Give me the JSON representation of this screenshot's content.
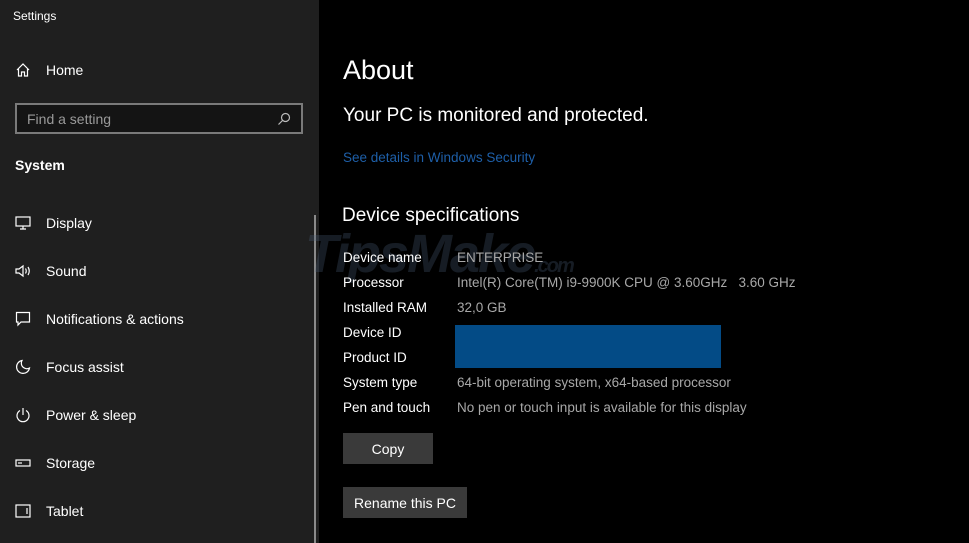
{
  "app_title": "Settings",
  "sidebar": {
    "home": "Home",
    "search_placeholder": "Find a setting",
    "section": "System",
    "items": [
      {
        "label": "Display",
        "icon": "monitor-icon"
      },
      {
        "label": "Sound",
        "icon": "speaker-icon"
      },
      {
        "label": "Notifications & actions",
        "icon": "notification-icon"
      },
      {
        "label": "Focus assist",
        "icon": "moon-icon"
      },
      {
        "label": "Power & sleep",
        "icon": "power-icon"
      },
      {
        "label": "Storage",
        "icon": "storage-icon"
      },
      {
        "label": "Tablet",
        "icon": "tablet-icon"
      }
    ]
  },
  "main": {
    "title": "About",
    "protection": "Your PC is monitored and protected.",
    "security_link": "See details in Windows Security",
    "specs_heading": "Device specifications",
    "specs": [
      {
        "label": "Device name",
        "value": "ENTERPRISE"
      },
      {
        "label": "Processor",
        "value": "Intel(R) Core(TM) i9-9900K CPU @ 3.60GHz   3.60 GHz"
      },
      {
        "label": "Installed RAM",
        "value": "32,0 GB"
      },
      {
        "label": "Device ID",
        "value": ""
      },
      {
        "label": "Product ID",
        "value": ""
      },
      {
        "label": "System type",
        "value": "64-bit operating system, x64-based processor"
      },
      {
        "label": "Pen and touch",
        "value": "No pen or touch input is available for this display"
      }
    ],
    "copy_button": "Copy",
    "rename_button": "Rename this PC"
  },
  "watermark": "TipsMake.com",
  "colors": {
    "link": "#1e5fa8",
    "redaction": "#034b86",
    "sidebar": "#1f1f1f"
  }
}
